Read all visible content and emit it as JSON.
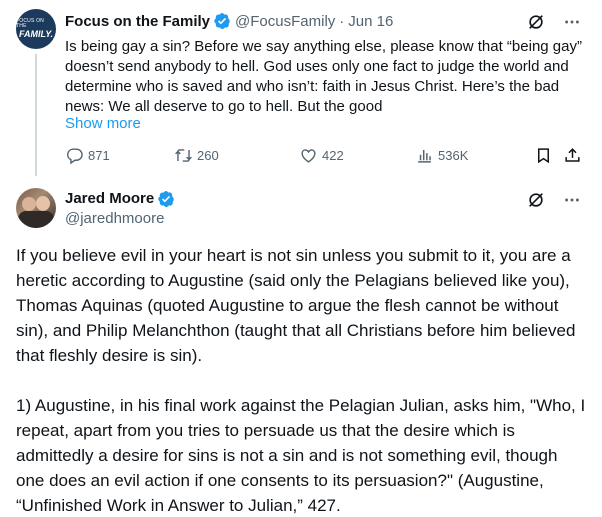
{
  "tweet1": {
    "avatar_text_small": "FOCUS ON THE",
    "avatar_text_big": "FAMILY.",
    "name": "Focus on the Family",
    "handle": "@FocusFamily",
    "separator": "·",
    "date": "Jun 16",
    "text": "Is being gay a sin? Before we say anything else, please know that “being gay” doesn’t send anybody to hell. God uses only one fact to judge the world and determine who is saved and who isn’t: faith in Jesus Christ. Here’s the bad news: We all deserve to go to hell. But the good",
    "show_more": "Show more",
    "stats": {
      "replies": "871",
      "reposts": "260",
      "likes": "422",
      "views": "536K"
    }
  },
  "tweet2": {
    "name": "Jared Moore",
    "handle": "@jaredhmoore",
    "paragraph1": "If you believe evil in your heart is not sin unless you submit to it, you are a heretic according to Augustine (said only the Pelagians believed like you), Thomas Aquinas (quoted Augustine to argue the flesh cannot be without sin), and Philip Melanchthon (taught that all Christians before him believed that fleshly desire is sin).",
    "paragraph2": "1) Augustine, in his final work against the Pelagian Julian, asks him, \"Who, I repeat, apart from you tries to persuade us that the desire which is admittedly a desire for sins is not a sin and is not something evil, though one does an evil action if one consents to its persuasion?\" (Augustine, “Unfinished Work in Answer to Julian,” 427."
  },
  "colors": {
    "text": "#0f1419",
    "secondary": "#536471",
    "link": "#1d9bf0",
    "verified": "#1d9bf0",
    "thread_line": "#cfd9de"
  },
  "icons": [
    "grok-icon",
    "more-icon",
    "reply-icon",
    "repost-icon",
    "like-icon",
    "views-icon",
    "bookmark-icon",
    "share-icon",
    "verified-badge-icon"
  ]
}
